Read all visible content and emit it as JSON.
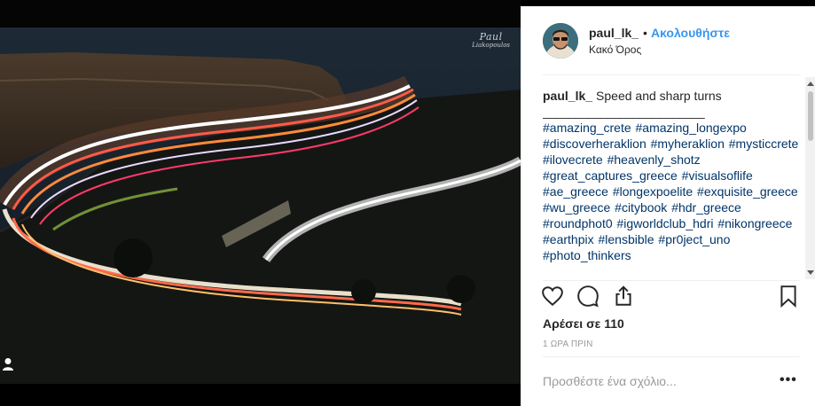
{
  "post": {
    "username": "paul_lk_",
    "separator": "•",
    "follow_label": "Ακολουθήστε",
    "location": "Κακό Όρος",
    "caption_user": "paul_lk_",
    "caption_text": "Speed and sharp turns",
    "caption_rule": "_________________________",
    "hashtags": "#amazing_crete #amazing_longexpo #discoverheraklion #myheraklion #mysticcrete #ilovecrete #heavenly_shotz #great_captures_greece #visualsoflife #ae_greece #longexpoelite #exquisite_greece #wu_greece #citybook #hdr_greece #roundphot0 #igworldclub_hdri #nikongreece #earthpix #lensbible #pr0ject_uno #photo_thinkers",
    "likes": "Αρέσει σε 110",
    "time_ago": "1 ΩΡΑ ΠΡΙΝ",
    "comment_placeholder": "Προσθέστε ένα σχόλιο...",
    "more_label": "•••"
  },
  "photo": {
    "watermark_line1": "Paul",
    "watermark_line2": "Liakopoulos"
  },
  "icons": {
    "like": "heart-icon",
    "comment": "comment-icon",
    "share": "share-icon",
    "save": "bookmark-icon",
    "tag": "person-icon"
  },
  "colors": {
    "follow": "#3897f0",
    "hashtag": "#003569",
    "text": "#262626",
    "muted": "#999999"
  }
}
